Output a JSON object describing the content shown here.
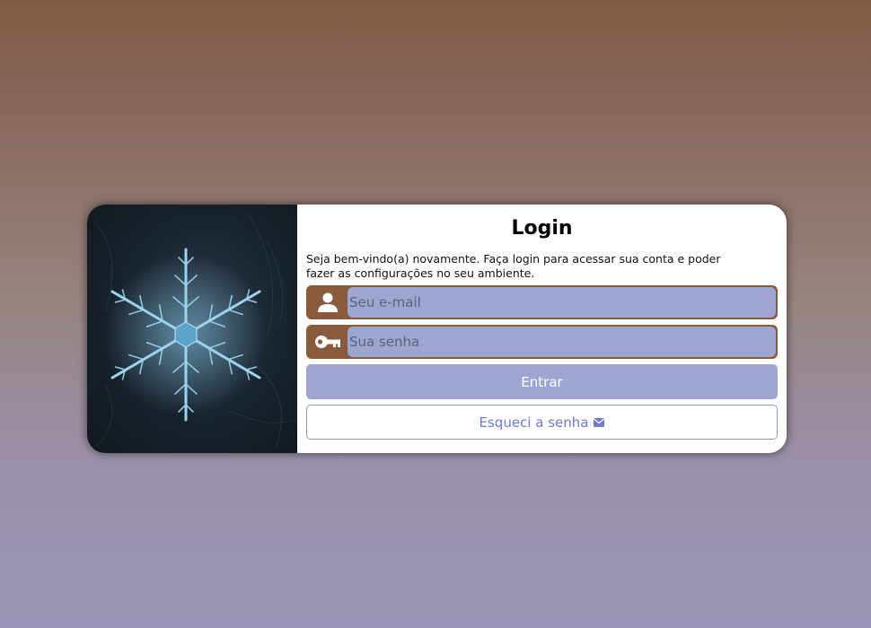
{
  "login": {
    "title": "Login",
    "subtitle": "Seja bem-vindo(a) novamente. Faça login para acessar sua conta e poder fazer as configurações no seu ambiente.",
    "email": {
      "placeholder": "Seu e-mail",
      "value": "",
      "icon": "user-icon"
    },
    "password": {
      "placeholder": "Sua senha",
      "value": "",
      "icon": "key-icon"
    },
    "submit_label": "Entrar",
    "forgot_label": "Esqueci a senha",
    "forgot_icon": "envelope-icon"
  },
  "colors": {
    "accent_brown": "#8a5a3c",
    "input_fill": "#9da6d0",
    "link_blue": "#7079d4"
  }
}
